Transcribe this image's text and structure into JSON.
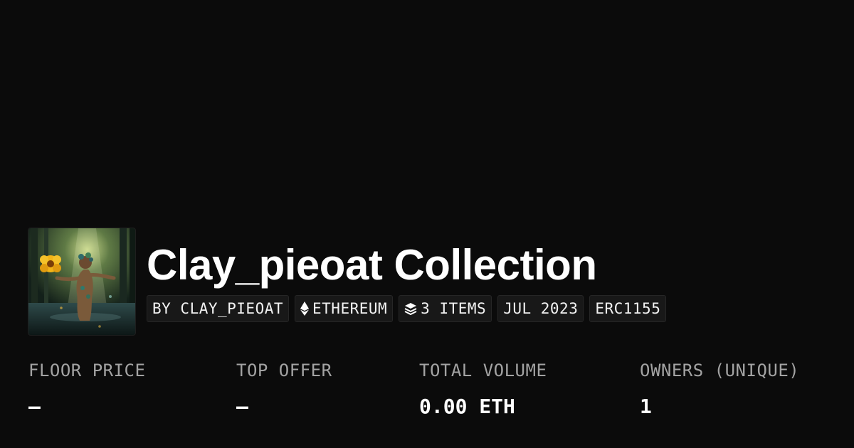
{
  "collection": {
    "title": "Clay_pieoat Collection",
    "thumbnail_alt": "collection-thumbnail"
  },
  "tags": {
    "creator": "BY CLAY_PIEOAT",
    "chain": "ETHEREUM",
    "chain_icon": "ethereum-icon",
    "items": "3 ITEMS",
    "items_icon": "layers-icon",
    "date": "JUL 2023",
    "standard": "ERC1155"
  },
  "stats": {
    "floor_price": {
      "label": "FLOOR PRICE",
      "value": "–"
    },
    "top_offer": {
      "label": "TOP OFFER",
      "value": "–"
    },
    "total_volume": {
      "label": "TOTAL VOLUME",
      "value": "0.00 ETH"
    },
    "owners": {
      "label": "OWNERS (UNIQUE)",
      "value": "1"
    }
  },
  "colors": {
    "background": "#0b0b0b",
    "tag_background": "#181818",
    "label": "#a3a3a3",
    "text": "#ffffff"
  }
}
